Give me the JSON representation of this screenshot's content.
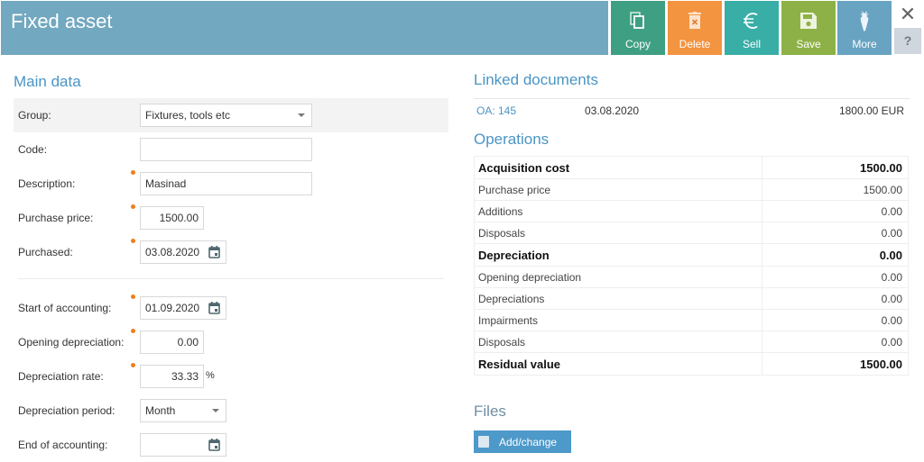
{
  "header": {
    "title": "Fixed asset",
    "buttons": {
      "copy": "Copy",
      "delete": "Delete",
      "sell": "Sell",
      "save": "Save",
      "more": "More"
    },
    "close_symbol": "✕",
    "help_symbol": "?",
    "colors": {
      "title_bar": "#72a8c0",
      "copy": "#3f9f82",
      "delete": "#f39441",
      "sell": "#38aea7",
      "save": "#8db146",
      "more": "#68a3c2"
    }
  },
  "main_data": {
    "title": "Main data",
    "fields": {
      "group": {
        "label": "Group:",
        "value": "Fixtures, tools etc"
      },
      "code": {
        "label": "Code:",
        "value": ""
      },
      "description": {
        "label": "Description:",
        "value": "Masinad"
      },
      "purchase_price": {
        "label": "Purchase price:",
        "value": "1500.00"
      },
      "purchased": {
        "label": "Purchased:",
        "value": "03.08.2020"
      },
      "start_of_accounting": {
        "label": "Start of accounting:",
        "value": "01.09.2020"
      },
      "opening_depreciation": {
        "label": "Opening depreciation:",
        "value": "0.00"
      },
      "depreciation_rate": {
        "label": "Depreciation rate:",
        "value": "33.33",
        "unit": "%"
      },
      "depreciation_period": {
        "label": "Depreciation period:",
        "value": "Month"
      },
      "end_of_accounting": {
        "label": "End of accounting:",
        "value": ""
      }
    }
  },
  "linked_documents": {
    "title": "Linked documents",
    "rows": [
      {
        "doc": "OA: 145",
        "date": "03.08.2020",
        "amount": "1800.00 EUR"
      }
    ]
  },
  "operations": {
    "title": "Operations",
    "rows": [
      {
        "label": "Acquisition cost",
        "value": "1500.00",
        "bold": true
      },
      {
        "label": "Purchase price",
        "value": "1500.00",
        "bold": false
      },
      {
        "label": "Additions",
        "value": "0.00",
        "bold": false
      },
      {
        "label": "Disposals",
        "value": "0.00",
        "bold": false
      },
      {
        "label": "Depreciation",
        "value": "0.00",
        "bold": true
      },
      {
        "label": "Opening depreciation",
        "value": "0.00",
        "bold": false
      },
      {
        "label": "Depreciations",
        "value": "0.00",
        "bold": false
      },
      {
        "label": "Impairments",
        "value": "0.00",
        "bold": false
      },
      {
        "label": "Disposals",
        "value": "0.00",
        "bold": false
      },
      {
        "label": "Residual value",
        "value": "1500.00",
        "bold": true
      }
    ]
  },
  "files": {
    "title": "Files",
    "add_button": "Add/change"
  }
}
